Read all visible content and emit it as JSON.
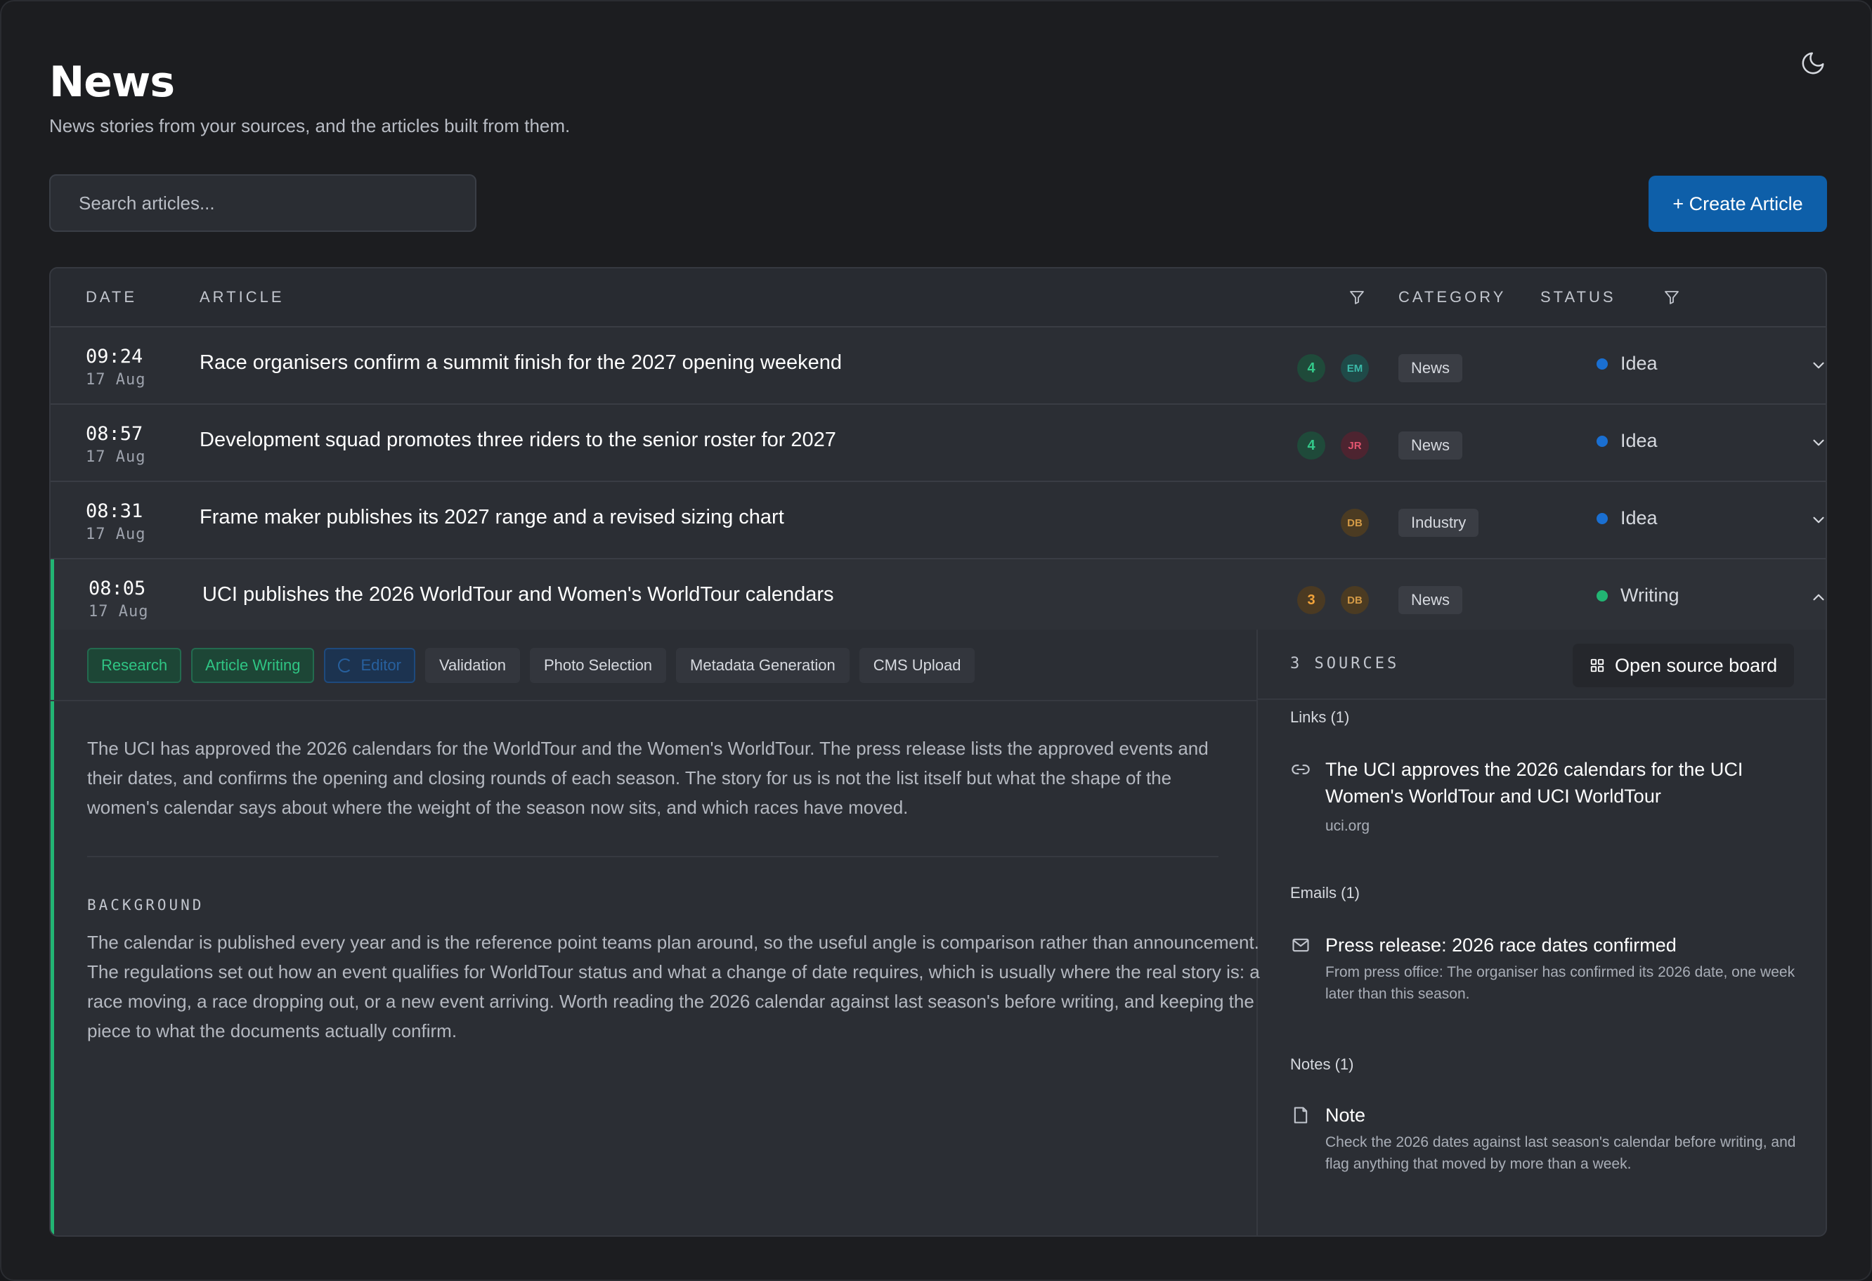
{
  "header": {
    "title": "News",
    "subtitle": "News stories from your sources, and the articles built from them."
  },
  "search": {
    "placeholder": "Search articles..."
  },
  "toolbar": {
    "create_label": "+ Create Article"
  },
  "table": {
    "columns": {
      "date": "DATE",
      "article": "ARTICLE",
      "category": "CATEGORY",
      "status": "STATUS"
    },
    "rows": [
      {
        "time": "09:24",
        "date": "17 Aug",
        "title": "Race organisers confirm a summit finish for the 2027 opening weekend",
        "count": "4",
        "avatar": "EM",
        "category": "News",
        "status": "Idea",
        "expanded": false
      },
      {
        "time": "08:57",
        "date": "17 Aug",
        "title": "Development squad promotes three riders to the senior roster for 2027",
        "count": "4",
        "avatar": "JR",
        "category": "News",
        "status": "Idea",
        "expanded": false
      },
      {
        "time": "08:31",
        "date": "17 Aug",
        "title": "Frame maker publishes its 2027 range and a revised sizing chart",
        "count": "",
        "avatar": "DB",
        "category": "Industry",
        "status": "Idea",
        "expanded": false
      },
      {
        "time": "08:05",
        "date": "17 Aug",
        "title": "UCI publishes the 2026 WorldTour and Women's WorldTour calendars",
        "count": "3",
        "avatar": "DB",
        "category": "News",
        "status": "Writing",
        "expanded": true
      }
    ]
  },
  "colors": {
    "accent": "#0e5fa9",
    "status_idea": "#1a6fd1",
    "status_writing": "#22b573",
    "expanded_bar": "#22b573"
  },
  "detail": {
    "pipeline": [
      {
        "label": "Research",
        "state": "done"
      },
      {
        "label": "Article Writing",
        "state": "done"
      },
      {
        "label": "Editor",
        "state": "active"
      },
      {
        "label": "Validation",
        "state": "pending"
      },
      {
        "label": "Photo Selection",
        "state": "pending"
      },
      {
        "label": "Metadata Generation",
        "state": "pending"
      },
      {
        "label": "CMS Upload",
        "state": "pending"
      }
    ],
    "summary": "The UCI has approved the 2026 calendars for the WorldTour and the Women's WorldTour. The press release lists the approved events and their dates, and confirms the opening and closing rounds of each season. The story for us is not the list itself but what the shape of the women's calendar says about where the weight of the season now sits, and which races have moved.",
    "background_label": "BACKGROUND",
    "background": "The calendar is published every year and is the reference point teams plan around, so the useful angle is comparison rather than announcement. The regulations set out how an event qualifies for WorldTour status and what a change of date requires, which is usually where the real story is: a race moving, a race dropping out, or a new event arriving. Worth reading the 2026 calendar against last season's before writing, and keeping the piece to what the documents actually confirm."
  },
  "sources": {
    "count_label": "3 SOURCES",
    "board_label": "Open source board",
    "links_label": "Links (1)",
    "link_title": "The UCI approves the 2026 calendars for the UCI Women's WorldTour and UCI WorldTour",
    "link_domain": "uci.org",
    "emails_label": "Emails (1)",
    "email_title": "Press release: 2026 race dates confirmed",
    "email_snippet": "From press office: The organiser has confirmed its 2026 date, one week later than this season.",
    "notes_label": "Notes (1)",
    "note_title": "Note",
    "note_snippet": "Check the 2026 dates against last season's calendar before writing, and flag anything that moved by more than a week."
  }
}
